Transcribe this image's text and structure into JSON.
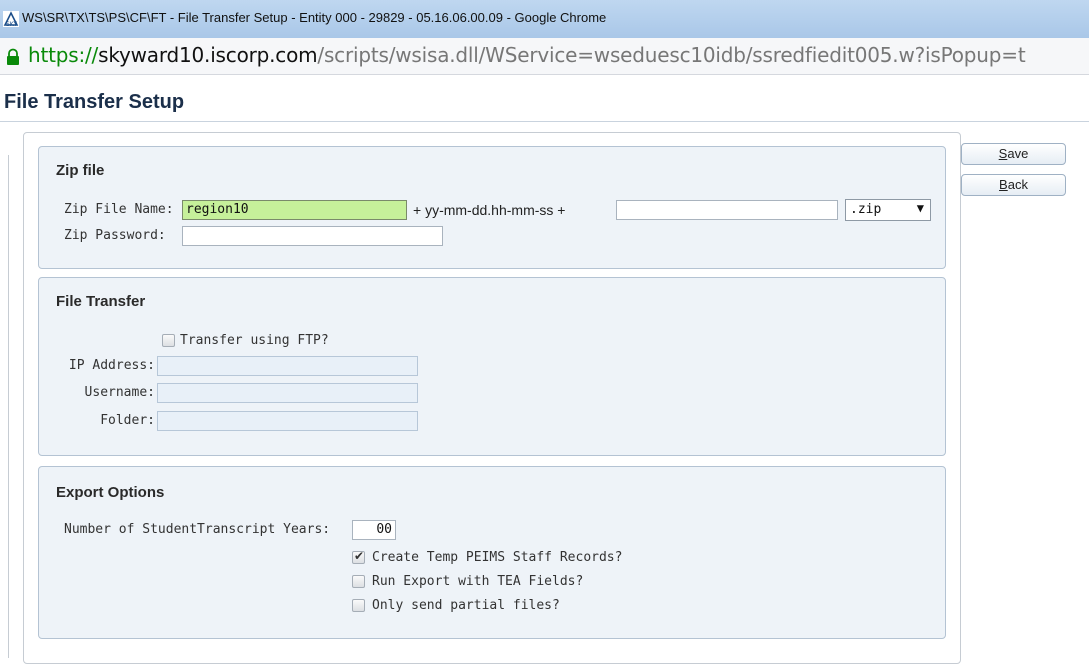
{
  "window": {
    "title": "WS\\SR\\TX\\TS\\PS\\CF\\FT - File Transfer Setup - Entity 000 - 29829 - 05.16.06.00.09 - Google Chrome",
    "url_scheme": "https://",
    "url_host": "skyward10.iscorp.com",
    "url_path": "/scripts/wsisa.dll/WService=wseduesc10idb/ssredfiedit005.w?isPopup=t"
  },
  "page": {
    "title": "File Transfer Setup"
  },
  "buttons": {
    "save_u": "S",
    "save_rest": "ave",
    "back_u": "B",
    "back_rest": "ack"
  },
  "zip_file": {
    "title": "Zip file",
    "name_label": "Zip File Name:",
    "name_value": "region10",
    "suffix_text": "+ yy-mm-dd.hh-mm-ss +",
    "suffix_value": "",
    "extension": ".zip",
    "password_label": "Zip Password:",
    "password_value": ""
  },
  "file_transfer": {
    "title": "File Transfer",
    "ftp_label": "Transfer using FTP?",
    "ftp_checked": false,
    "ip_label": "IP Address:",
    "ip_value": "",
    "username_label": "Username:",
    "username_value": "",
    "folder_label": "Folder:",
    "folder_value": ""
  },
  "export_options": {
    "title": "Export Options",
    "years_label": "Number of StudentTranscript Years:",
    "years_value": "00",
    "options": [
      {
        "label": "Create Temp PEIMS Staff Records?",
        "checked": true
      },
      {
        "label": "Run Export with TEA Fields?",
        "checked": false
      },
      {
        "label": "Only send partial files?",
        "checked": false
      }
    ]
  }
}
